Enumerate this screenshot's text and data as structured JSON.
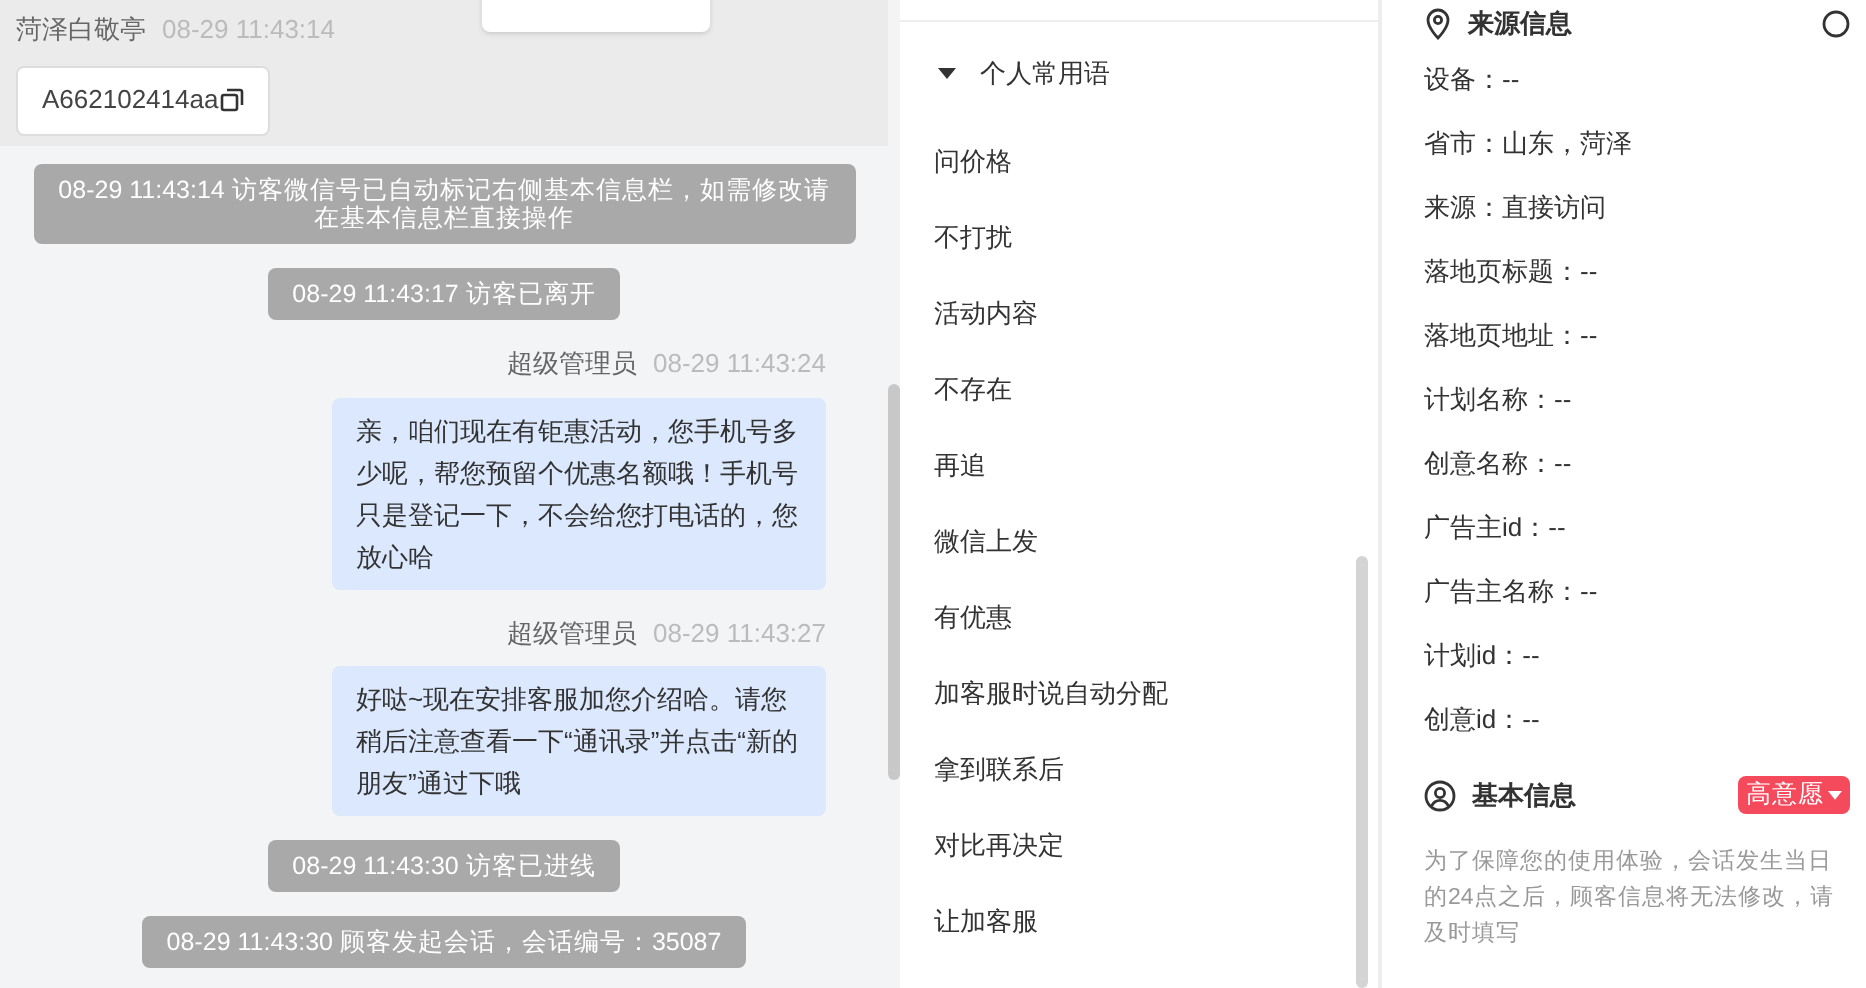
{
  "chat": {
    "visitor_name": "菏泽白敬亭",
    "visitor_time": "08-29 11:43:14",
    "wechat_id": "A662102414aa",
    "messages": [
      {
        "kind": "system",
        "text": "08-29 11:43:14 访客微信号已自动标记右侧基本信息栏，如需修改请在基本信息栏直接操作"
      },
      {
        "kind": "system",
        "text": "08-29 11:43:17 访客已离开"
      },
      {
        "kind": "agent",
        "sender": "超级管理员",
        "time": "08-29 11:43:24",
        "text": "亲，咱们现在有钜惠活动，您手机号多少呢，帮您预留个优惠名额哦！手机号只是登记一下，不会给您打电话的，您放心哈"
      },
      {
        "kind": "agent",
        "sender": "超级管理员",
        "time": "08-29 11:43:27",
        "text": "好哒~现在安排客服加您介绍哈。请您稍后注意查看一下“通讯录”并点击“新的朋友”通过下哦"
      },
      {
        "kind": "system",
        "text": "08-29 11:43:30 访客已进线"
      },
      {
        "kind": "system",
        "text": "08-29 11:43:30 顾客发起会话，会话编号：35087"
      }
    ]
  },
  "quick_replies": {
    "group": {
      "label": "个人常用语",
      "expanded": true
    },
    "items": [
      "问价格",
      "不打扰",
      "活动内容",
      "不存在",
      "再追",
      "微信上发",
      "有优惠",
      "加客服时说自动分配",
      "拿到联系后",
      "对比再决定",
      "让加客服"
    ]
  },
  "source_info": {
    "title": "来源信息",
    "fields": [
      "设备：--",
      "省市：山东，菏泽",
      "来源：直接访问",
      "落地页标题：--",
      "落地页地址：--",
      "计划名称：--",
      "创意名称：--",
      "广告主id：--",
      "广告主名称：--",
      "计划id：--",
      "创意id：--"
    ]
  },
  "basic_info": {
    "title": "基本信息",
    "intent": "高意愿",
    "notice": "为了保障您的使用体验，会话发生当日的24点之后，顾客信息将无法修改，请及时填写"
  }
}
